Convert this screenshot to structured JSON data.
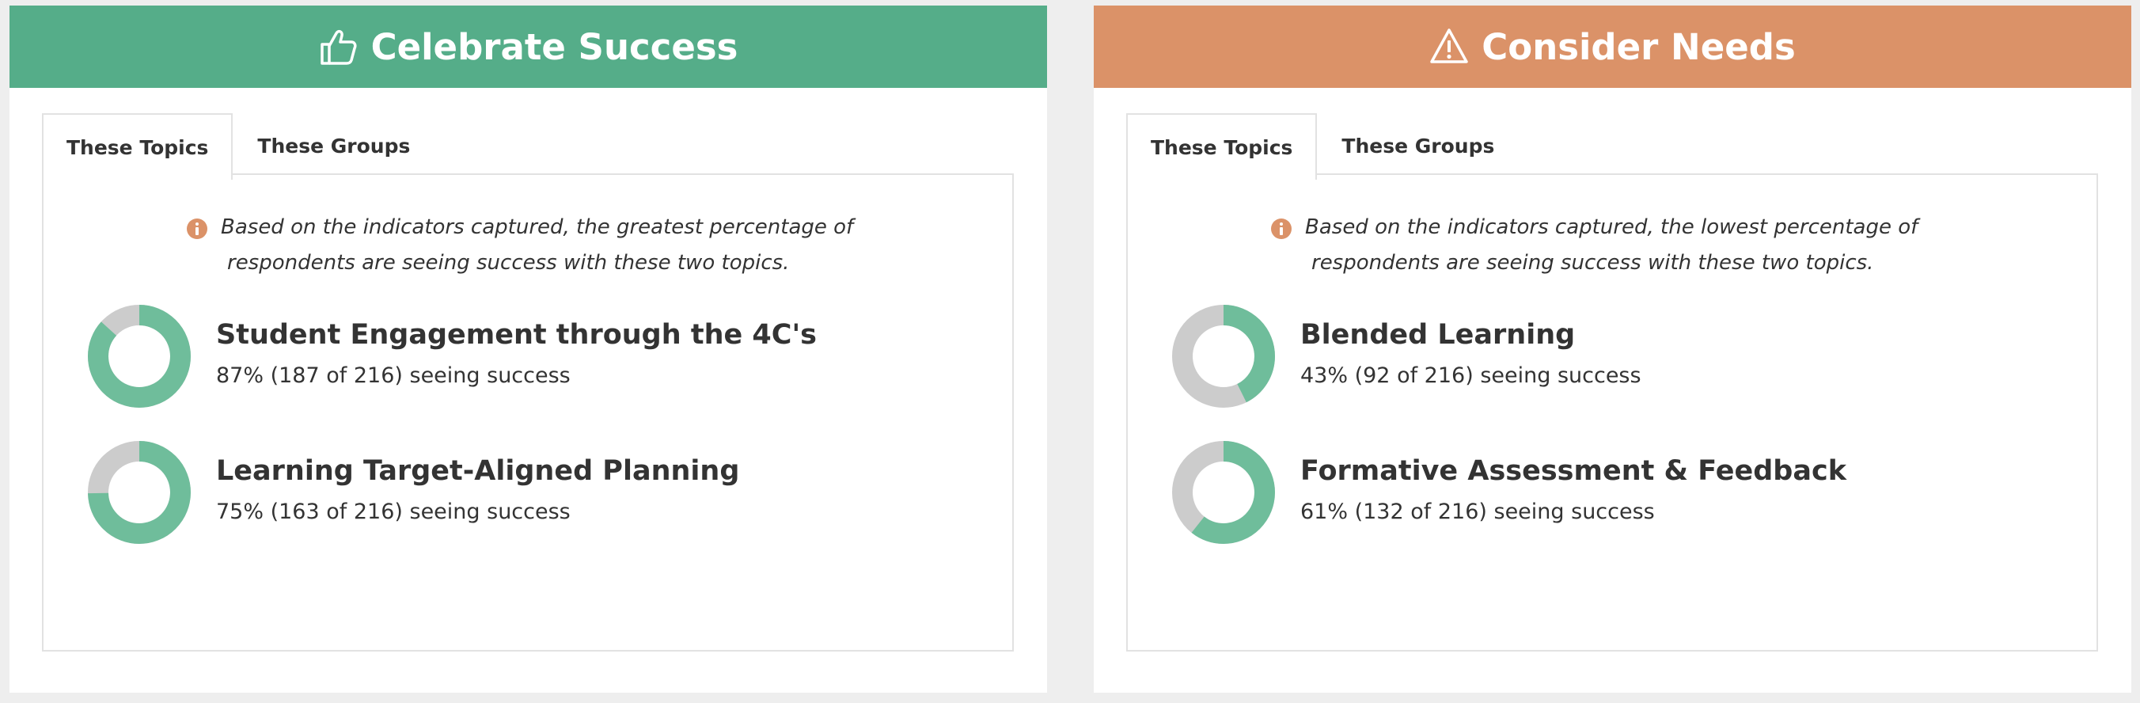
{
  "colors": {
    "success_header": "#55ad89",
    "needs_header": "#db9268",
    "donut_fill": "#6fbd9b",
    "donut_track": "#cccccc",
    "info_icon": "#db9268"
  },
  "panels": [
    {
      "title": "Celebrate Success",
      "icon": "thumbs-up-icon",
      "tabs": [
        {
          "label": "These Topics",
          "active": true
        },
        {
          "label": "These Groups",
          "active": false
        }
      ],
      "note": {
        "line1": "Based on the indicators captured, the greatest percentage of",
        "line2": "respondents are seeing success with these two topics."
      },
      "topics": [
        {
          "title": "Student Engagement through the 4C's",
          "stat": "87% (187 of 216) seeing success",
          "percent": 87
        },
        {
          "title": "Learning Target-Aligned Planning",
          "stat": "75% (163 of 216) seeing success",
          "percent": 75
        }
      ]
    },
    {
      "title": "Consider Needs",
      "icon": "warning-triangle-icon",
      "tabs": [
        {
          "label": "These Topics",
          "active": true
        },
        {
          "label": "These Groups",
          "active": false
        }
      ],
      "note": {
        "line1": "Based on the indicators captured, the lowest percentage of",
        "line2": "respondents are seeing success with these two topics."
      },
      "topics": [
        {
          "title": "Blended Learning",
          "stat": "43% (92 of 216) seeing success",
          "percent": 43
        },
        {
          "title": "Formative Assessment & Feedback",
          "stat": "61% (132 of 216) seeing success",
          "percent": 61
        }
      ]
    }
  ]
}
